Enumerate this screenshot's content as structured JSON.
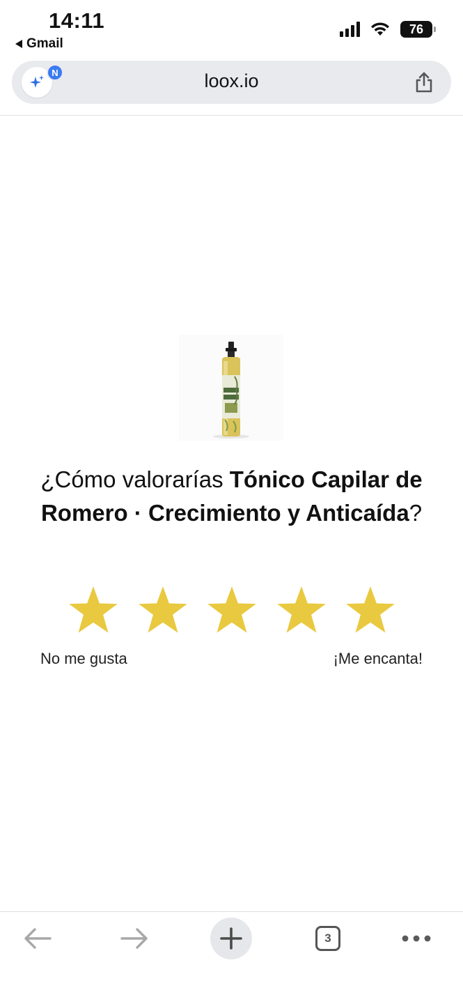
{
  "status_bar": {
    "time": "14:11",
    "back_app": "Gmail",
    "battery": "76"
  },
  "browser": {
    "url": "loox.io",
    "ai_badge": "N",
    "tab_count": "3"
  },
  "review": {
    "question_prefix": "¿Cómo valorarías ",
    "product_name": "Tónico Capilar de Romero · Crecimiento y Anticaída",
    "question_suffix": "?",
    "rating_value": 5,
    "rating_max": 5,
    "low_label": "No me gusta",
    "high_label": "¡Me encanta!",
    "star_color": "#e9c93f"
  },
  "icons": {
    "back_arrow": "arrow-left-icon",
    "forward_arrow": "arrow-right-icon",
    "new_tab": "plus-icon",
    "more": "more-dots-icon",
    "share": "share-icon",
    "ai": "sparkle-icon"
  }
}
